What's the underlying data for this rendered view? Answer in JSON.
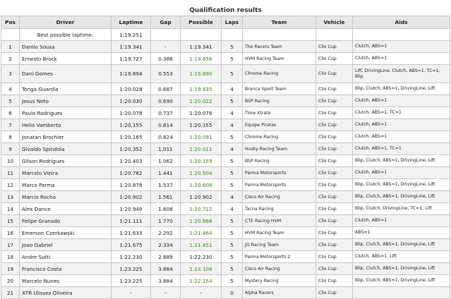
{
  "title": "Qualification results",
  "headers": [
    "Pos",
    "Driver",
    "Laptime",
    "Gap",
    "Possible",
    "Laps",
    "Team",
    "Vehicle",
    "Aids"
  ],
  "best": {
    "label": "Best possible laptime:",
    "time": "1:19.251"
  },
  "rows": [
    {
      "pos": "1",
      "driver": "Danilo Sousa",
      "laptime": "1:19.341",
      "gap": "-",
      "possible": "1:19.341",
      "possible_green": false,
      "laps": "5",
      "team": "The Racers Team",
      "vehicle": "Clio Cup",
      "aids": "Clutch, ABS=1"
    },
    {
      "pos": "2",
      "driver": "Ernesto Brock",
      "laptime": "1:19.727",
      "gap": "0.386",
      "possible": "1:19.656",
      "possible_green": true,
      "laps": "5",
      "team": "HVM Racing Team",
      "vehicle": "Clio Cup",
      "aids": "Clutch, ABS=1"
    },
    {
      "pos": "3",
      "driver": "Dani Gomes",
      "laptime": "1:19.894",
      "gap": "0.553",
      "possible": "1:19.890",
      "possible_green": true,
      "laps": "5",
      "team": "Chrome Racing",
      "vehicle": "Clio Cup",
      "aids": "Lift, DrivingLine, Clutch, ABS=1, TC=1, Blip",
      "tall": true
    },
    {
      "pos": "4",
      "driver": "Tonga Guardia",
      "laptime": "1:20.028",
      "gap": "0.687",
      "possible": "1:19.935",
      "possible_green": true,
      "laps": "4",
      "team": "Branca Sport Team",
      "vehicle": "Clio Cup",
      "aids": "Blip, Clutch, ABS=1, DrivingLine, Lift"
    },
    {
      "pos": "5",
      "driver": "Jesus Neto",
      "laptime": "1:20.030",
      "gap": "0.690",
      "possible": "1:20.022",
      "possible_green": true,
      "laps": "5",
      "team": "BSP Racing",
      "vehicle": "Clio Cup",
      "aids": "Clutch, ABS=1"
    },
    {
      "pos": "6",
      "driver": "Paulo Rodrigues",
      "laptime": "1:20.078",
      "gap": "0.737",
      "possible": "1:20.078",
      "possible_green": false,
      "laps": "4",
      "team": "Time Xtraté",
      "vehicle": "Clio Cup",
      "aids": "Clutch, ABS=1, TC=1"
    },
    {
      "pos": "7",
      "driver": "Helio Vamberto",
      "laptime": "1:20.155",
      "gap": "0.814",
      "possible": "1:20.155",
      "possible_green": false,
      "laps": "4",
      "team": "Equipe Piratas",
      "vehicle": "Clio Cup",
      "aids": "Clutch, ABS=1"
    },
    {
      "pos": "8",
      "driver": "Jonatan Brochier",
      "laptime": "1:20.165",
      "gap": "0.824",
      "possible": "1:20.091",
      "possible_green": true,
      "laps": "5",
      "team": "Chrome Racing",
      "vehicle": "Clio Cup",
      "aids": "Clutch, ABS=1"
    },
    {
      "pos": "9",
      "driver": "Givaldo Spindola",
      "laptime": "1:20.352",
      "gap": "1.011",
      "possible": "1:20.011",
      "possible_green": true,
      "laps": "4",
      "team": "Husky Racing Team",
      "vehicle": "Clio Cup",
      "aids": "Clutch, ABS=1, TC=1"
    },
    {
      "pos": "10",
      "driver": "Gilson Rodrigues",
      "laptime": "1:20.403",
      "gap": "1.062",
      "possible": "1:20.159",
      "possible_green": true,
      "laps": "5",
      "team": "BSP Racing",
      "vehicle": "Clio Cup",
      "aids": "Blip, Clutch, ABS=1, DrivingLine, Lift"
    },
    {
      "pos": "11",
      "driver": "Marcelo Vieira",
      "laptime": "1:20.782",
      "gap": "1.441",
      "possible": "1:20.504",
      "possible_green": true,
      "laps": "5",
      "team": "Parma Motorsports",
      "vehicle": "Clio Cup",
      "aids": "Clutch, ABS=1"
    },
    {
      "pos": "12",
      "driver": "Marco Parma",
      "laptime": "1:20.878",
      "gap": "1.537",
      "possible": "1:20.608",
      "possible_green": true,
      "laps": "5",
      "team": "Parma Motorsports",
      "vehicle": "Clio Cup",
      "aids": "Blip, Clutch, ABS=1, DrivingLine, Lift"
    },
    {
      "pos": "13",
      "driver": "Marcio Rocha",
      "laptime": "1:20.902",
      "gap": "1.561",
      "possible": "1:20.902",
      "possible_green": false,
      "laps": "4",
      "team": "Cisco Air Racing",
      "vehicle": "Clio Cup",
      "aids": "Blip, Clutch, ABS=1, DrivingLine, Lift"
    },
    {
      "pos": "14",
      "driver": "Alex Dance",
      "laptime": "1:20.949",
      "gap": "1.608",
      "possible": "1:20.712",
      "possible_green": true,
      "laps": "4",
      "team": "Tacna Racing",
      "vehicle": "Clio Cup",
      "aids": "Blip, Clutch, DrivingLine, TC=1, Lift"
    },
    {
      "pos": "15",
      "driver": "Felipe Granado",
      "laptime": "1:21.111",
      "gap": "1.770",
      "possible": "1:20.868",
      "possible_green": true,
      "laps": "5",
      "team": "CTE Racing HVM",
      "vehicle": "Clio Cup",
      "aids": "Clutch, ABS=1"
    },
    {
      "pos": "16",
      "driver": "Emerson Czerkawski",
      "laptime": "1:21.633",
      "gap": "2.292",
      "possible": "1:21.464",
      "possible_green": true,
      "laps": "5",
      "team": "HVM Racing Team",
      "vehicle": "Clio Cup",
      "aids": "ABS=1"
    },
    {
      "pos": "17",
      "driver": "Joao Gabriel",
      "laptime": "1:21.675",
      "gap": "2.334",
      "possible": "1:21.451",
      "possible_green": true,
      "laps": "5",
      "team": "JO Racing Team",
      "vehicle": "Clio Cup",
      "aids": "Blip, Clutch, ABS=1, DrivingLine, Lift"
    },
    {
      "pos": "18",
      "driver": "Andre Sutti",
      "laptime": "1:22.230",
      "gap": "2.889",
      "possible": "1:22.230",
      "possible_green": false,
      "laps": "5",
      "team": "Parma Motorsports 2",
      "vehicle": "Clio Cup",
      "aids": "Clutch, ABS=1, Lift"
    },
    {
      "pos": "19",
      "driver": "Francisco Costa",
      "laptime": "1:23.225",
      "gap": "3.884",
      "possible": "1:23.108",
      "possible_green": true,
      "laps": "5",
      "team": "Cisco Air Racing",
      "vehicle": "Clio Cup",
      "aids": "Blip, Clutch, ABS=1, DrivingLine, Lift"
    },
    {
      "pos": "20",
      "driver": "Marcelo Nunes",
      "laptime": "1:23.225",
      "gap": "3.884",
      "possible": "1:22.154",
      "possible_green": true,
      "laps": "5",
      "team": "Mystery Racing",
      "vehicle": "Clio Cup",
      "aids": "Blip, Clutch, ABS=1, DrivingLine, Lift"
    },
    {
      "pos": "21",
      "driver": "XTR Ulisses Oliveira",
      "laptime": "-",
      "gap": "-",
      "possible": "-",
      "possible_green": false,
      "laps": "0",
      "team": "Alpha Racers",
      "vehicle": "Clio Cup",
      "aids": ""
    }
  ],
  "colors": {
    "possible_improved": "#3c8a1e",
    "header_bg": "#e6e6e6",
    "row_alt": "#f2f2f2",
    "border": "#c8c8c8"
  }
}
